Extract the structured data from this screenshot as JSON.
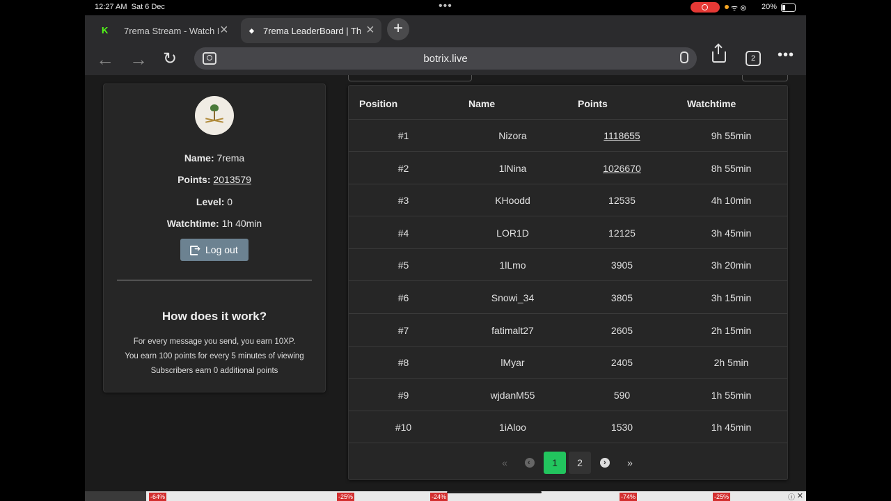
{
  "status": {
    "time": "12:27 AM",
    "date": "Sat 6 Dec",
    "battery": "20%"
  },
  "browser": {
    "tabs": [
      {
        "title": "7rema Stream - Watch L",
        "favicon": "K",
        "favicon_color": "#53fc18",
        "active": false
      },
      {
        "title": "7rema LeaderBoard | Th",
        "favicon": "◆",
        "favicon_color": "#ffffff",
        "active": true
      }
    ],
    "new_tab": "+",
    "url": "botrix.live",
    "tab_count": "2"
  },
  "profile": {
    "name_label": "Name:",
    "name": "7rema",
    "points_label": "Points:",
    "points": "2013579",
    "level_label": "Level:",
    "level": "0",
    "watchtime_label": "Watchtime:",
    "watchtime": "1h 40min",
    "logout_label": "Log out",
    "how_title": "How does it work?",
    "rules": [
      "For every message you send, you earn 10XP.",
      "You earn 100 points for every 5 minutes of viewing",
      "Subscribers earn 0 additional points"
    ]
  },
  "leaderboard": {
    "headers": [
      "Position",
      "Name",
      "Points",
      "Watchtime"
    ],
    "rows": [
      {
        "position": "#1",
        "name": "Nizora",
        "points": "1118655",
        "watchtime": "9h 55min",
        "points_link": true
      },
      {
        "position": "#2",
        "name": "1lNina",
        "points": "1026670",
        "watchtime": "8h 55min",
        "points_link": true
      },
      {
        "position": "#3",
        "name": "KHoodd",
        "points": "12535",
        "watchtime": "4h 10min",
        "points_link": false
      },
      {
        "position": "#4",
        "name": "LOR1D",
        "points": "12125",
        "watchtime": "3h 45min",
        "points_link": false
      },
      {
        "position": "#5",
        "name": "1lLmo",
        "points": "3905",
        "watchtime": "3h 20min",
        "points_link": false
      },
      {
        "position": "#6",
        "name": "Snowi_34",
        "points": "3805",
        "watchtime": "3h 15min",
        "points_link": false
      },
      {
        "position": "#7",
        "name": "fatimalt27",
        "points": "2605",
        "watchtime": "2h 15min",
        "points_link": false
      },
      {
        "position": "#8",
        "name": "lMyar",
        "points": "2405",
        "watchtime": "2h 5min",
        "points_link": false
      },
      {
        "position": "#9",
        "name": "wjdanM55",
        "points": "590",
        "watchtime": "1h 55min",
        "points_link": false
      },
      {
        "position": "#10",
        "name": "1iAloo",
        "points": "1530",
        "watchtime": "1h 45min",
        "points_link": false
      }
    ],
    "pagination": {
      "first": "«",
      "pages": [
        "1",
        "2"
      ],
      "current": "1",
      "last": "»"
    }
  },
  "ad": {
    "discounts": [
      "-64%",
      "-25%",
      "-24%",
      "-74%",
      "-25%"
    ]
  },
  "colors": {
    "accent_green": "#22c55e",
    "logout_button": "#6c8291",
    "card_bg": "#262626",
    "page_bg": "#1b1b1b"
  }
}
